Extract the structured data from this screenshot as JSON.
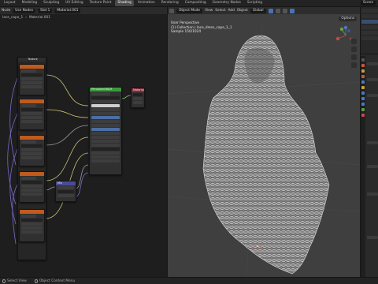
{
  "topbar": {
    "tabs": [
      "Layout",
      "Modeling",
      "Sculpting",
      "UV Editing",
      "Texture Paint",
      "Shading",
      "Animation",
      "Rendering",
      "Compositing",
      "Geometry Nodes",
      "Scripting"
    ],
    "active_tab": "Shading",
    "scene_label": "Scene"
  },
  "node_editor": {
    "header": {
      "editor_type": "Node",
      "use_nodes": "Use Nodes",
      "slot": "Slot 1",
      "material": "Material.001"
    },
    "breadcrumb": {
      "object": "lace_cape_1",
      "material": "Material.001"
    },
    "nodes": [
      {
        "id": "frame",
        "label": "Texture"
      },
      {
        "id": "bsdf",
        "label": "Principled BSDF"
      },
      {
        "id": "output",
        "label": "Material Output"
      },
      {
        "id": "mix",
        "label": "Mix"
      }
    ]
  },
  "viewport": {
    "header": {
      "mode": "Object Mode",
      "menus": [
        "View",
        "Select",
        "Add",
        "Object"
      ],
      "transform": "Global"
    },
    "info": {
      "perspective": "User Perspective",
      "collection": "(1) Collection | lace_dress_cape_1_1",
      "sample": "Sample 150/1024"
    },
    "options_label": "Options"
  },
  "statusbar": {
    "items": [
      "Select View",
      "Object Context Menu"
    ]
  },
  "colors": {
    "node_header_orange": "#c05a1e",
    "node_header_green": "#3a9a3a",
    "node_header_red": "#8a2a3a",
    "node_header_purple": "#4a4a9a",
    "wire_yellow": "#c8c070",
    "wire_gray": "#9a9a9a",
    "wire_purple": "#7a6ac8",
    "viewport_bg": "#3f3f3f",
    "axis_red": "#c84848",
    "axis_green": "#6aa04a",
    "axis_blue": "#4a78c8"
  }
}
